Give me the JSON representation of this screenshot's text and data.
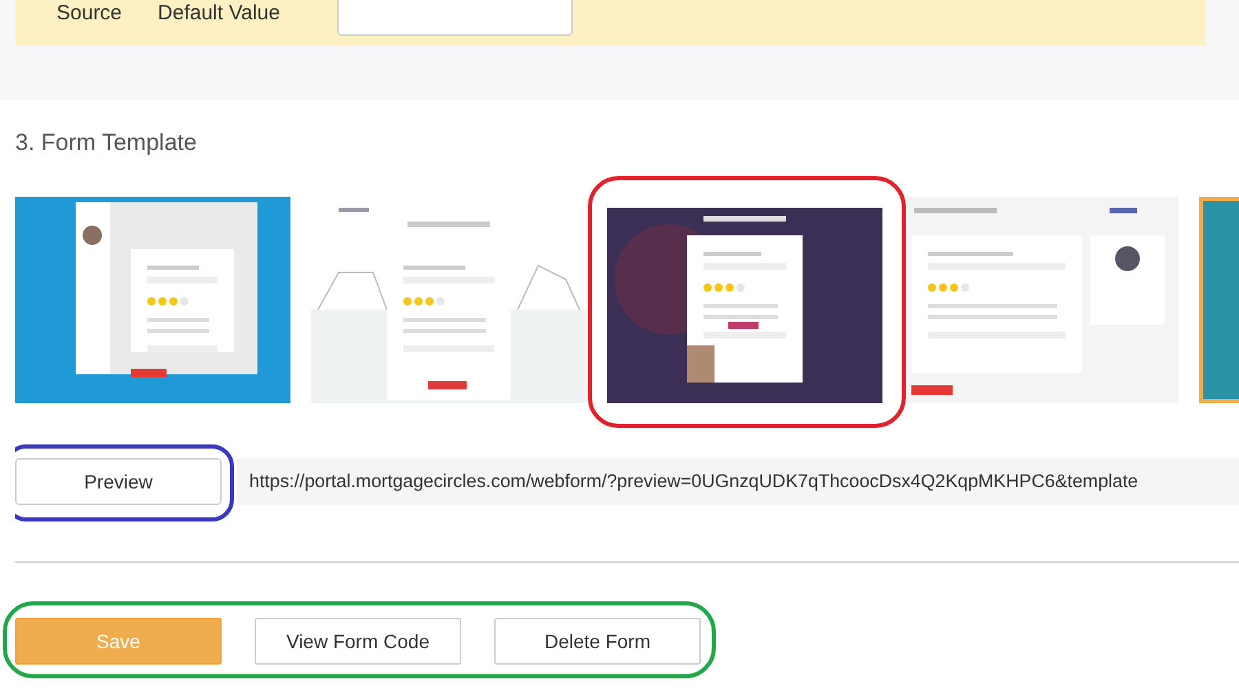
{
  "mapping": {
    "columns": [
      "Source",
      "Default Value"
    ]
  },
  "form_template": {
    "heading": "3. Form Template",
    "templates": [
      {
        "kind": "blue",
        "selected": false
      },
      {
        "kind": "houses",
        "selected": false
      },
      {
        "kind": "dark",
        "selected": false
      },
      {
        "kind": "profile",
        "selected": false
      },
      {
        "kind": "teal",
        "selected": true
      }
    ],
    "preview": {
      "button": "Preview",
      "url": "https://portal.mortgagecircles.com/webform/?preview=0UGnzqUDK7qThcoocDsx4Q2KqpMKHPC6&template"
    }
  },
  "actions": {
    "buttons": [
      {
        "label": "Save",
        "kind": "primary"
      },
      {
        "label": "View Form Code",
        "kind": "default"
      },
      {
        "label": "Delete Form",
        "kind": "default"
      }
    ]
  },
  "annotations": [
    {
      "color": "#e4202a"
    },
    {
      "color": "#3838c0"
    },
    {
      "color": "#22a84a"
    }
  ]
}
